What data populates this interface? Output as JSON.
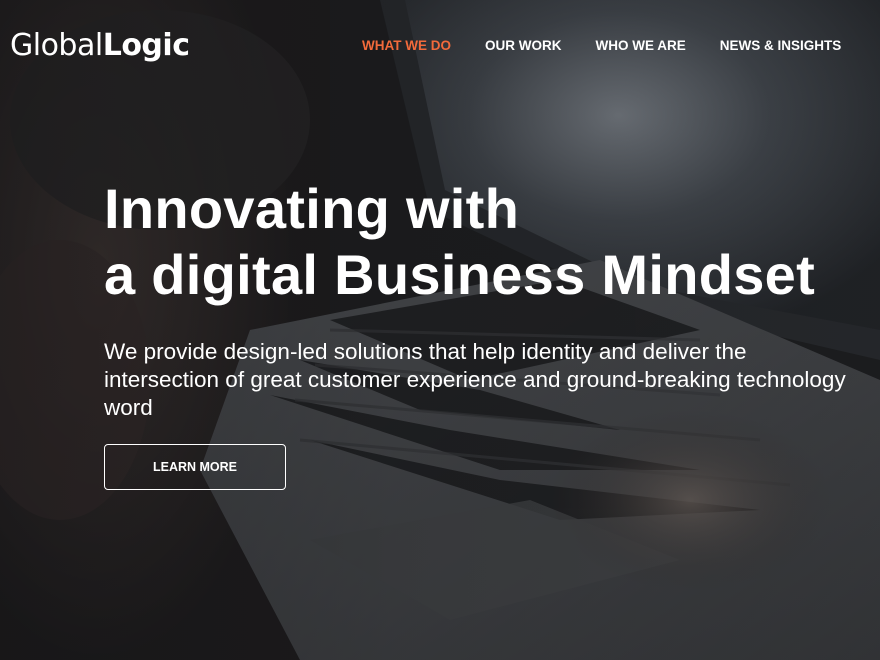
{
  "brand": {
    "logo_light": "Global",
    "logo_bold": "Logic"
  },
  "nav": {
    "items": [
      {
        "label": "WHAT WE DO",
        "active": true
      },
      {
        "label": "OUR WORK",
        "active": false
      },
      {
        "label": "WHO WE ARE",
        "active": false
      },
      {
        "label": "NEWS & INSIGHTS",
        "active": false
      }
    ]
  },
  "hero": {
    "title_line1": "Innovating with",
    "title_line2": "a digital Business Mindset",
    "subtitle_line1": "We provide design-led solutions that help identity and deliver the",
    "subtitle_line2": "intersection of great customer experience and ground-breaking technology",
    "subtitle_line3": "word",
    "cta_label": "LEARN MORE"
  },
  "colors": {
    "accent": "#f26a3b",
    "text": "#ffffff",
    "background": "#1c1d1f"
  }
}
